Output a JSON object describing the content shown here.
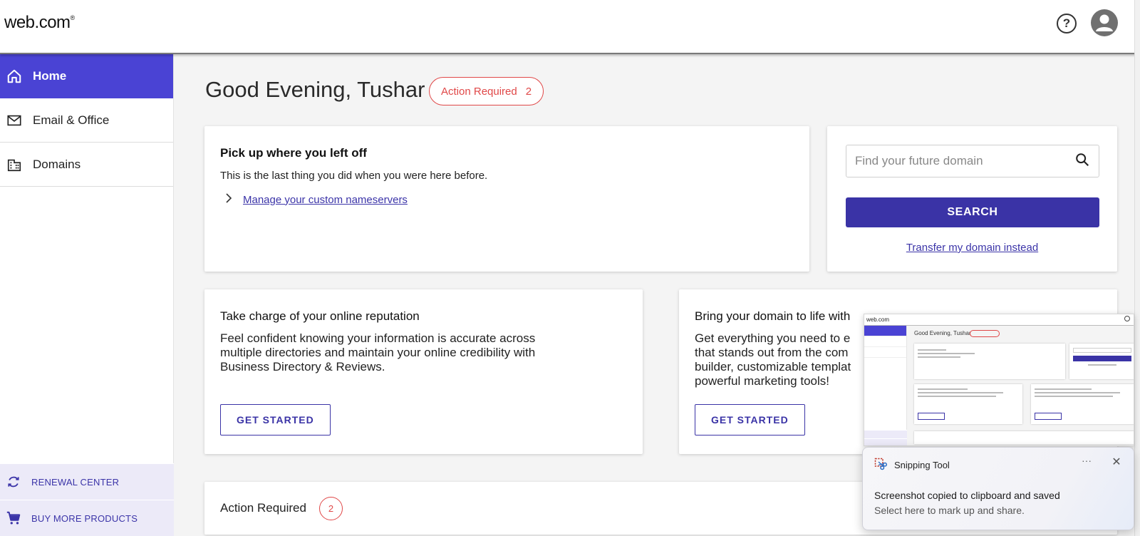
{
  "header": {
    "logo": "web.com",
    "logo_mark": "®",
    "help_icon": "help-circle-icon",
    "help_symbol": "?",
    "avatar_icon": "user-avatar-icon"
  },
  "sidebar": {
    "items": [
      {
        "label": "Home",
        "icon": "home-icon",
        "active": true
      },
      {
        "label": "Email & Office",
        "icon": "mail-icon",
        "active": false
      },
      {
        "label": "Domains",
        "icon": "building-icon",
        "active": false
      }
    ],
    "bottom_links": [
      {
        "label": "RENEWAL CENTER",
        "icon": "refresh-icon"
      },
      {
        "label": "BUY MORE PRODUCTS",
        "icon": "cart-icon"
      }
    ]
  },
  "main": {
    "greeting": "Good Evening, Tushar",
    "action_pill": {
      "label": "Action Required",
      "count": "2"
    },
    "resume_card": {
      "title": "Pick up where you left off",
      "description": "This is the last thing you did when you were here before.",
      "link": "Manage your custom nameservers"
    },
    "domain_search": {
      "placeholder": "Find your future domain",
      "button": "SEARCH",
      "transfer_link": "Transfer my domain instead"
    },
    "reputation_card": {
      "title": "Take charge of your online reputation",
      "body": "Feel confident knowing your information is accurate across multiple directories and maintain your online credibility with Business Directory & Reviews.",
      "button": "GET STARTED"
    },
    "site_card": {
      "title": "Bring your domain to life with",
      "body": "Get everything you need to e that stands out from the com builder, customizable templat powerful marketing tools!",
      "button": "GET STARTED"
    },
    "action_required": {
      "label": "Action Required",
      "count": "2"
    }
  },
  "thumbnail": {
    "logo": "web.com",
    "greeting": "Good Evening, Tushar"
  },
  "notification": {
    "app_name": "Snipping Tool",
    "title": "Screenshot copied to clipboard and saved",
    "subtitle": "Select here to mark up and share.",
    "more": "···",
    "close": "✕"
  },
  "colors": {
    "brand_primary": "#4a43d4",
    "button_primary": "#3a33a6",
    "alert_red": "#e04848",
    "background": "#f4f4f4"
  }
}
